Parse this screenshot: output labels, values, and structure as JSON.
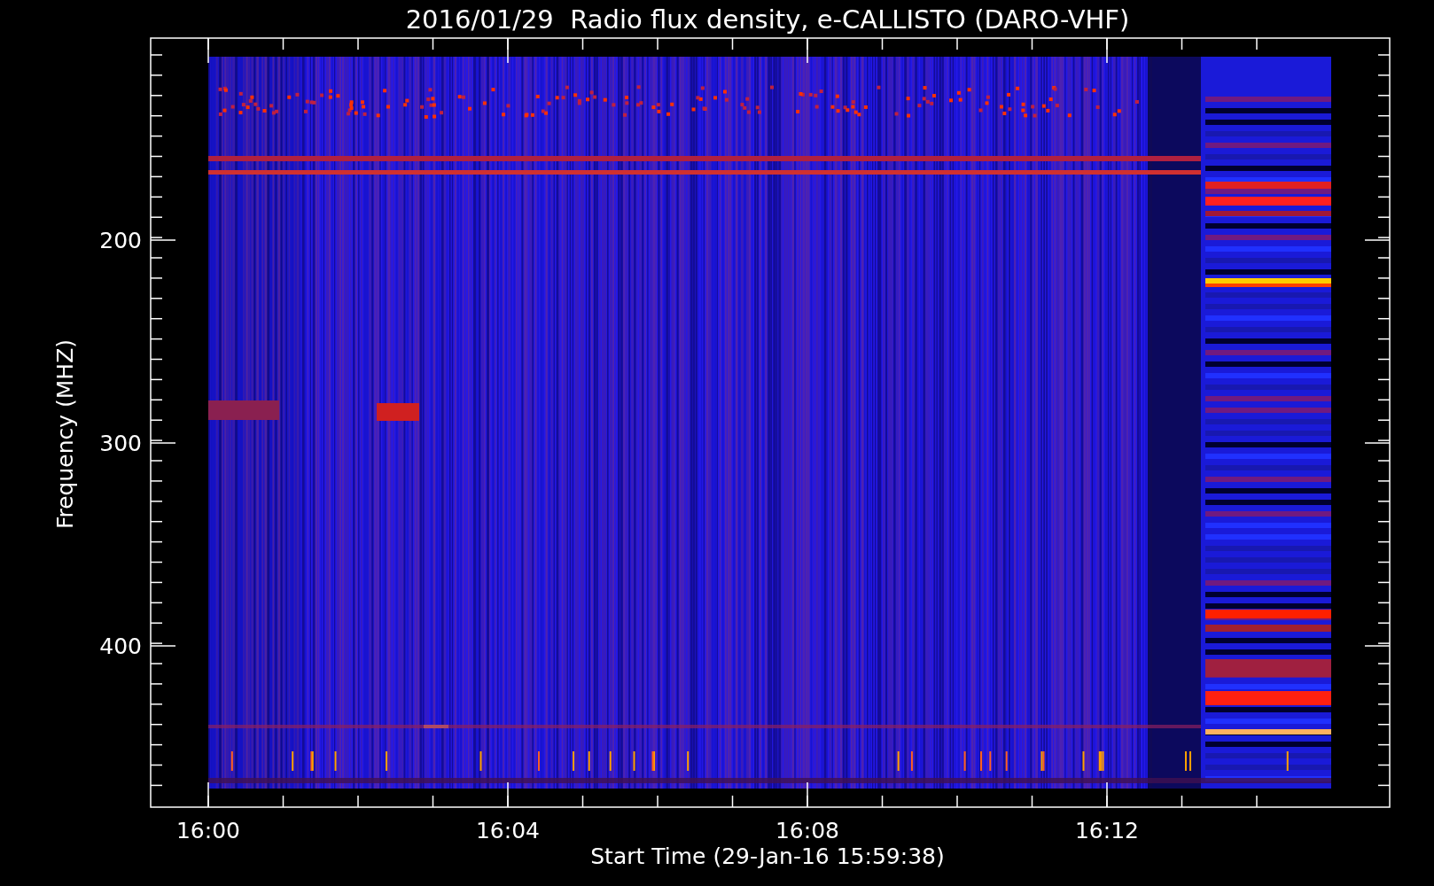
{
  "title": "2016/01/29  Radio flux density, e-CALLISTO (DARO-VHF)",
  "ylabel": "Frequency (MHZ)",
  "xlabel": "Start Time (29-Jan-16 15:59:38)",
  "yticks": [
    "200",
    "300",
    "400"
  ],
  "xticks": [
    "16:00",
    "16:04",
    "16:08",
    "16:12"
  ]
}
